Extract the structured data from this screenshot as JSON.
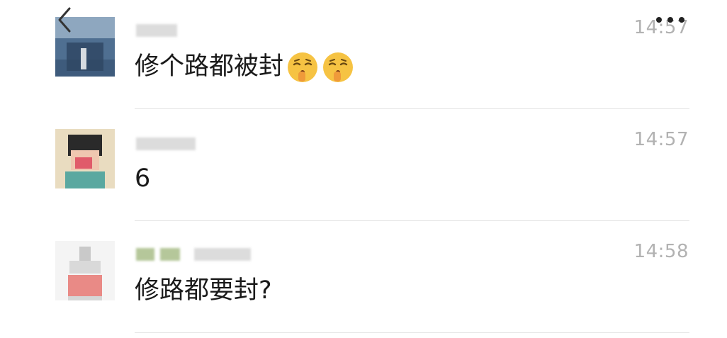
{
  "header": {
    "back_icon": "chevron-left-icon",
    "more_icon": "more-dots-icon"
  },
  "messages": [
    {
      "time": "14:57",
      "text": "修个路都被封",
      "emojis": [
        "shushing-face-emoji",
        "shushing-face-emoji"
      ]
    },
    {
      "time": "14:57",
      "text": "6"
    },
    {
      "time": "14:58",
      "text": "修路都要封?"
    }
  ],
  "colors": {
    "time": "#b2b2b2",
    "text": "#1a1a1a",
    "divider": "#e5e5e5"
  }
}
